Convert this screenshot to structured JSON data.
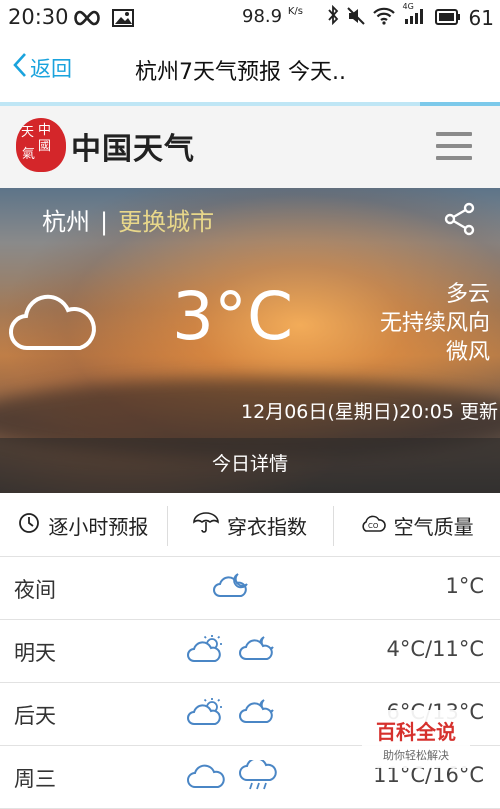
{
  "status_bar": {
    "time": "20:30",
    "network_speed": "98.9",
    "network_unit": "K/s",
    "signal_label": "4G",
    "battery": "61"
  },
  "title_bar": {
    "back_label": "返回",
    "title": "杭州7天气预报 今天.."
  },
  "header": {
    "brand": "中国天气",
    "seal_chars": [
      "中",
      "國",
      "天",
      "氣"
    ]
  },
  "hero": {
    "city": "杭州",
    "separator": "|",
    "change_city": "更换城市",
    "temperature": "3°C",
    "condition": "多云",
    "wind_direction": "无持续风向",
    "wind_level": "微风",
    "updated": "12月06日(星期日)20:05 更新",
    "today_details": "今日详情"
  },
  "tabs": [
    {
      "label": "逐小时预报",
      "icon": "clock-icon"
    },
    {
      "label": "穿衣指数",
      "icon": "umbrella-icon"
    },
    {
      "label": "空气质量",
      "icon": "co2-cloud-icon"
    }
  ],
  "forecast": [
    {
      "day": "夜间",
      "icons": [
        "cloud-moon-icon"
      ],
      "temp": "1°C"
    },
    {
      "day": "明天",
      "icons": [
        "sun-cloud-icon",
        "cloud-moon-icon"
      ],
      "temp": "4°C/11°C"
    },
    {
      "day": "后天",
      "icons": [
        "sun-cloud-icon",
        "cloud-moon-icon"
      ],
      "temp": "6°C/13°C"
    },
    {
      "day": "周三",
      "icons": [
        "cloud-icon",
        "cloud-rain-icon"
      ],
      "temp": "11°C/16°C"
    }
  ],
  "watermark": {
    "main": "百科全说",
    "sub": "助你轻松解决"
  },
  "colors": {
    "accent": "#1aa3dd",
    "change_city": "#e8d78a",
    "seal": "#d4262a",
    "forecast_icon": "#4a86c5"
  }
}
